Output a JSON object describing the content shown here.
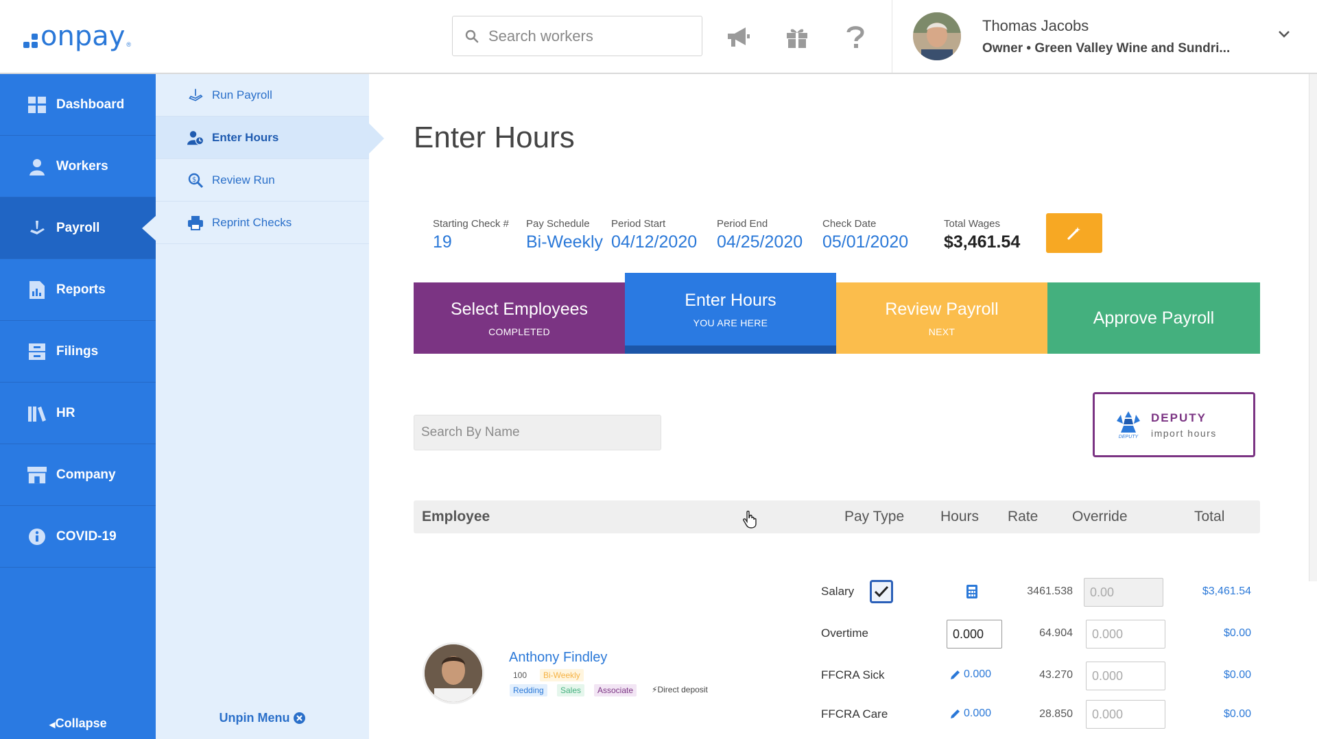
{
  "header": {
    "logo_text": "onpay",
    "logo_reg": "®",
    "search_placeholder": "Search workers",
    "user_name": "Thomas Jacobs",
    "user_role": "Owner • Green Valley Wine and Sundri..."
  },
  "nav": {
    "items": [
      {
        "label": "Dashboard",
        "icon": "dashboard-icon"
      },
      {
        "label": "Workers",
        "icon": "workers-icon"
      },
      {
        "label": "Payroll",
        "icon": "payroll-icon"
      },
      {
        "label": "Reports",
        "icon": "reports-icon"
      },
      {
        "label": "Filings",
        "icon": "filings-icon"
      },
      {
        "label": "HR",
        "icon": "hr-icon"
      },
      {
        "label": "Company",
        "icon": "company-icon"
      },
      {
        "label": "COVID-19",
        "icon": "info-icon"
      }
    ],
    "collapse_label": "Collapse"
  },
  "submenu": {
    "items": [
      {
        "label": "Run Payroll"
      },
      {
        "label": "Enter Hours"
      },
      {
        "label": "Review Run"
      },
      {
        "label": "Reprint Checks"
      }
    ],
    "unpin_label": "Unpin Menu"
  },
  "page": {
    "title": "Enter Hours",
    "stats": {
      "check_label": "Starting Check #",
      "check_value": "19",
      "schedule_label": "Pay Schedule",
      "schedule_value": "Bi-Weekly",
      "start_label": "Period Start",
      "start_value": "04/12/2020",
      "end_label": "Period End",
      "end_value": "04/25/2020",
      "date_label": "Check Date",
      "date_value": "05/01/2020",
      "wages_label": "Total Wages",
      "wages_value": "$3,461.54"
    },
    "steps": [
      {
        "title": "Select Employees",
        "sub": "COMPLETED"
      },
      {
        "title": "Enter Hours",
        "sub": "YOU ARE HERE"
      },
      {
        "title": "Review Payroll",
        "sub": "NEXT"
      },
      {
        "title": "Approve Payroll",
        "sub": ""
      }
    ],
    "search_name_placeholder": "Search By Name",
    "deputy": {
      "title": "DEPUTY",
      "sub": "import hours",
      "logo_text": "DEPUTY"
    },
    "table_headers": {
      "employee": "Employee",
      "pay_type": "Pay Type",
      "hours": "Hours",
      "rate": "Rate",
      "override": "Override",
      "total": "Total"
    },
    "employee": {
      "name": "Anthony Findley",
      "id": "100",
      "schedule_tag": "Bi-Weekly",
      "tags": [
        "Redding",
        "Sales",
        "Associate"
      ],
      "deposit": "Direct deposit"
    },
    "rows": [
      {
        "type": "Salary",
        "hours": "",
        "rate": "3461.538",
        "override_placeholder": "0.00",
        "total": "$3,461.54"
      },
      {
        "type": "Overtime",
        "hours": "0.000",
        "rate": "64.904",
        "override_placeholder": "0.000",
        "total": "$0.00"
      },
      {
        "type": "FFCRA Sick",
        "hours": "0.000",
        "rate": "43.270",
        "override_placeholder": "0.000",
        "total": "$0.00"
      },
      {
        "type": "FFCRA Care",
        "hours": "0.000",
        "rate": "28.850",
        "override_placeholder": "0.000",
        "total": "$0.00"
      }
    ]
  },
  "colors": {
    "brand_blue": "#2a7ae2",
    "purple": "#7b3483",
    "yellow": "#fbbd4c",
    "green": "#44b07e",
    "orange": "#f7a823"
  }
}
